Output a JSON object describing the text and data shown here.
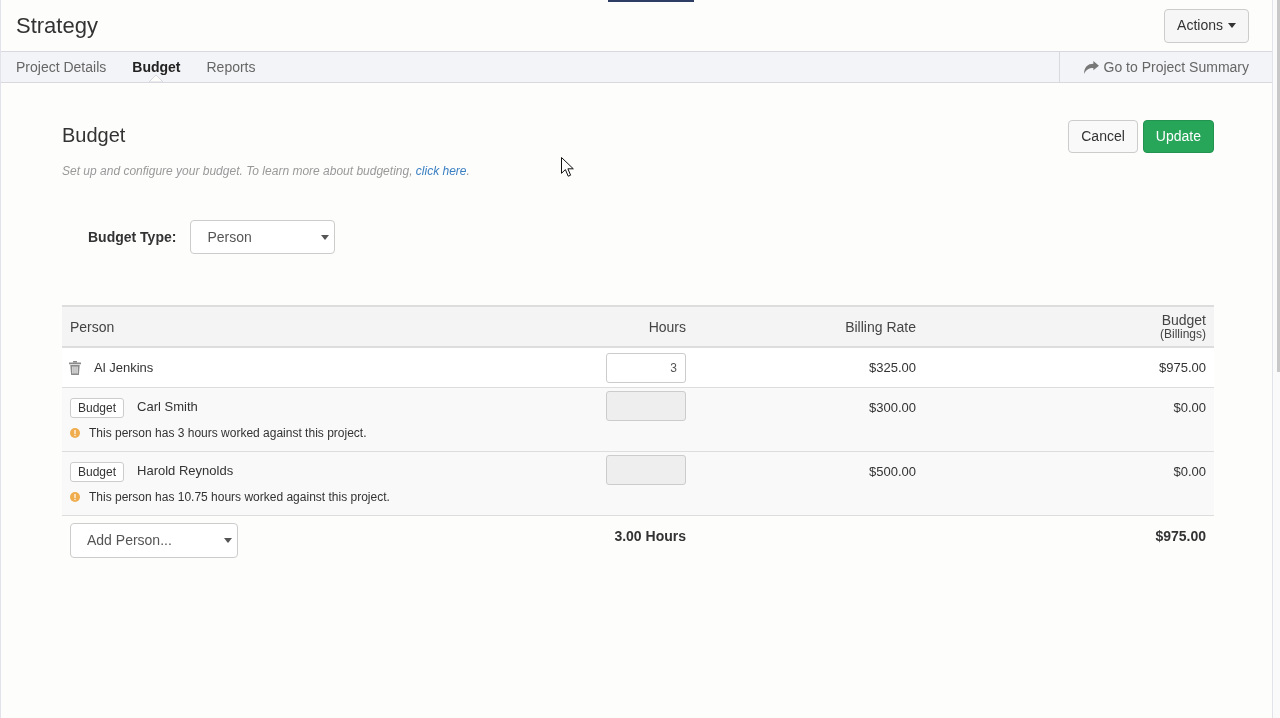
{
  "page": {
    "title": "Strategy"
  },
  "actions_button": {
    "label": "Actions"
  },
  "tabs": [
    {
      "label": "Project Details",
      "selected": false
    },
    {
      "label": "Budget",
      "selected": true
    },
    {
      "label": "Reports",
      "selected": false
    }
  ],
  "summary_link": {
    "label": "Go to Project Summary"
  },
  "budget": {
    "heading": "Budget",
    "description": "Set up and configure your budget. To learn more about budgeting, ",
    "link": "click here",
    "description_end": ".",
    "buttons": [
      {
        "label": "Cancel",
        "kind": "default"
      },
      {
        "label": "Update",
        "kind": "primary"
      }
    ]
  },
  "budget_type": {
    "label": "Budget Type:",
    "value": "Person"
  },
  "table": {
    "columns": [
      {
        "label": "Person"
      },
      {
        "label": "Hours"
      },
      {
        "label": "Billing Rate"
      },
      {
        "label": "Budget",
        "sublabel": "(Billings)"
      }
    ],
    "rows": [
      {
        "kind": "budgeted",
        "name": "Al Jenkins",
        "hours": {
          "value": "3",
          "disabled": false
        },
        "billing_rate": "$325.00",
        "budget": "$975.00"
      },
      {
        "kind": "unbudgeted",
        "action": "Budget",
        "name": "Carl Smith",
        "warning": "This person has 3 hours worked against this project.",
        "hours": {
          "disabled": true
        },
        "billing_rate": "$300.00",
        "budget": "$0.00"
      },
      {
        "kind": "unbudgeted",
        "action": "Budget",
        "name": "Harold Reynolds",
        "warning": "This person has 10.75 hours worked against this project.",
        "hours": {
          "disabled": true
        },
        "billing_rate": "$500.00",
        "budget": "$0.00"
      }
    ],
    "footer": {
      "add_person": "Add Person...",
      "total_hours": "3.00 Hours",
      "total_budget": "$975.00"
    }
  }
}
